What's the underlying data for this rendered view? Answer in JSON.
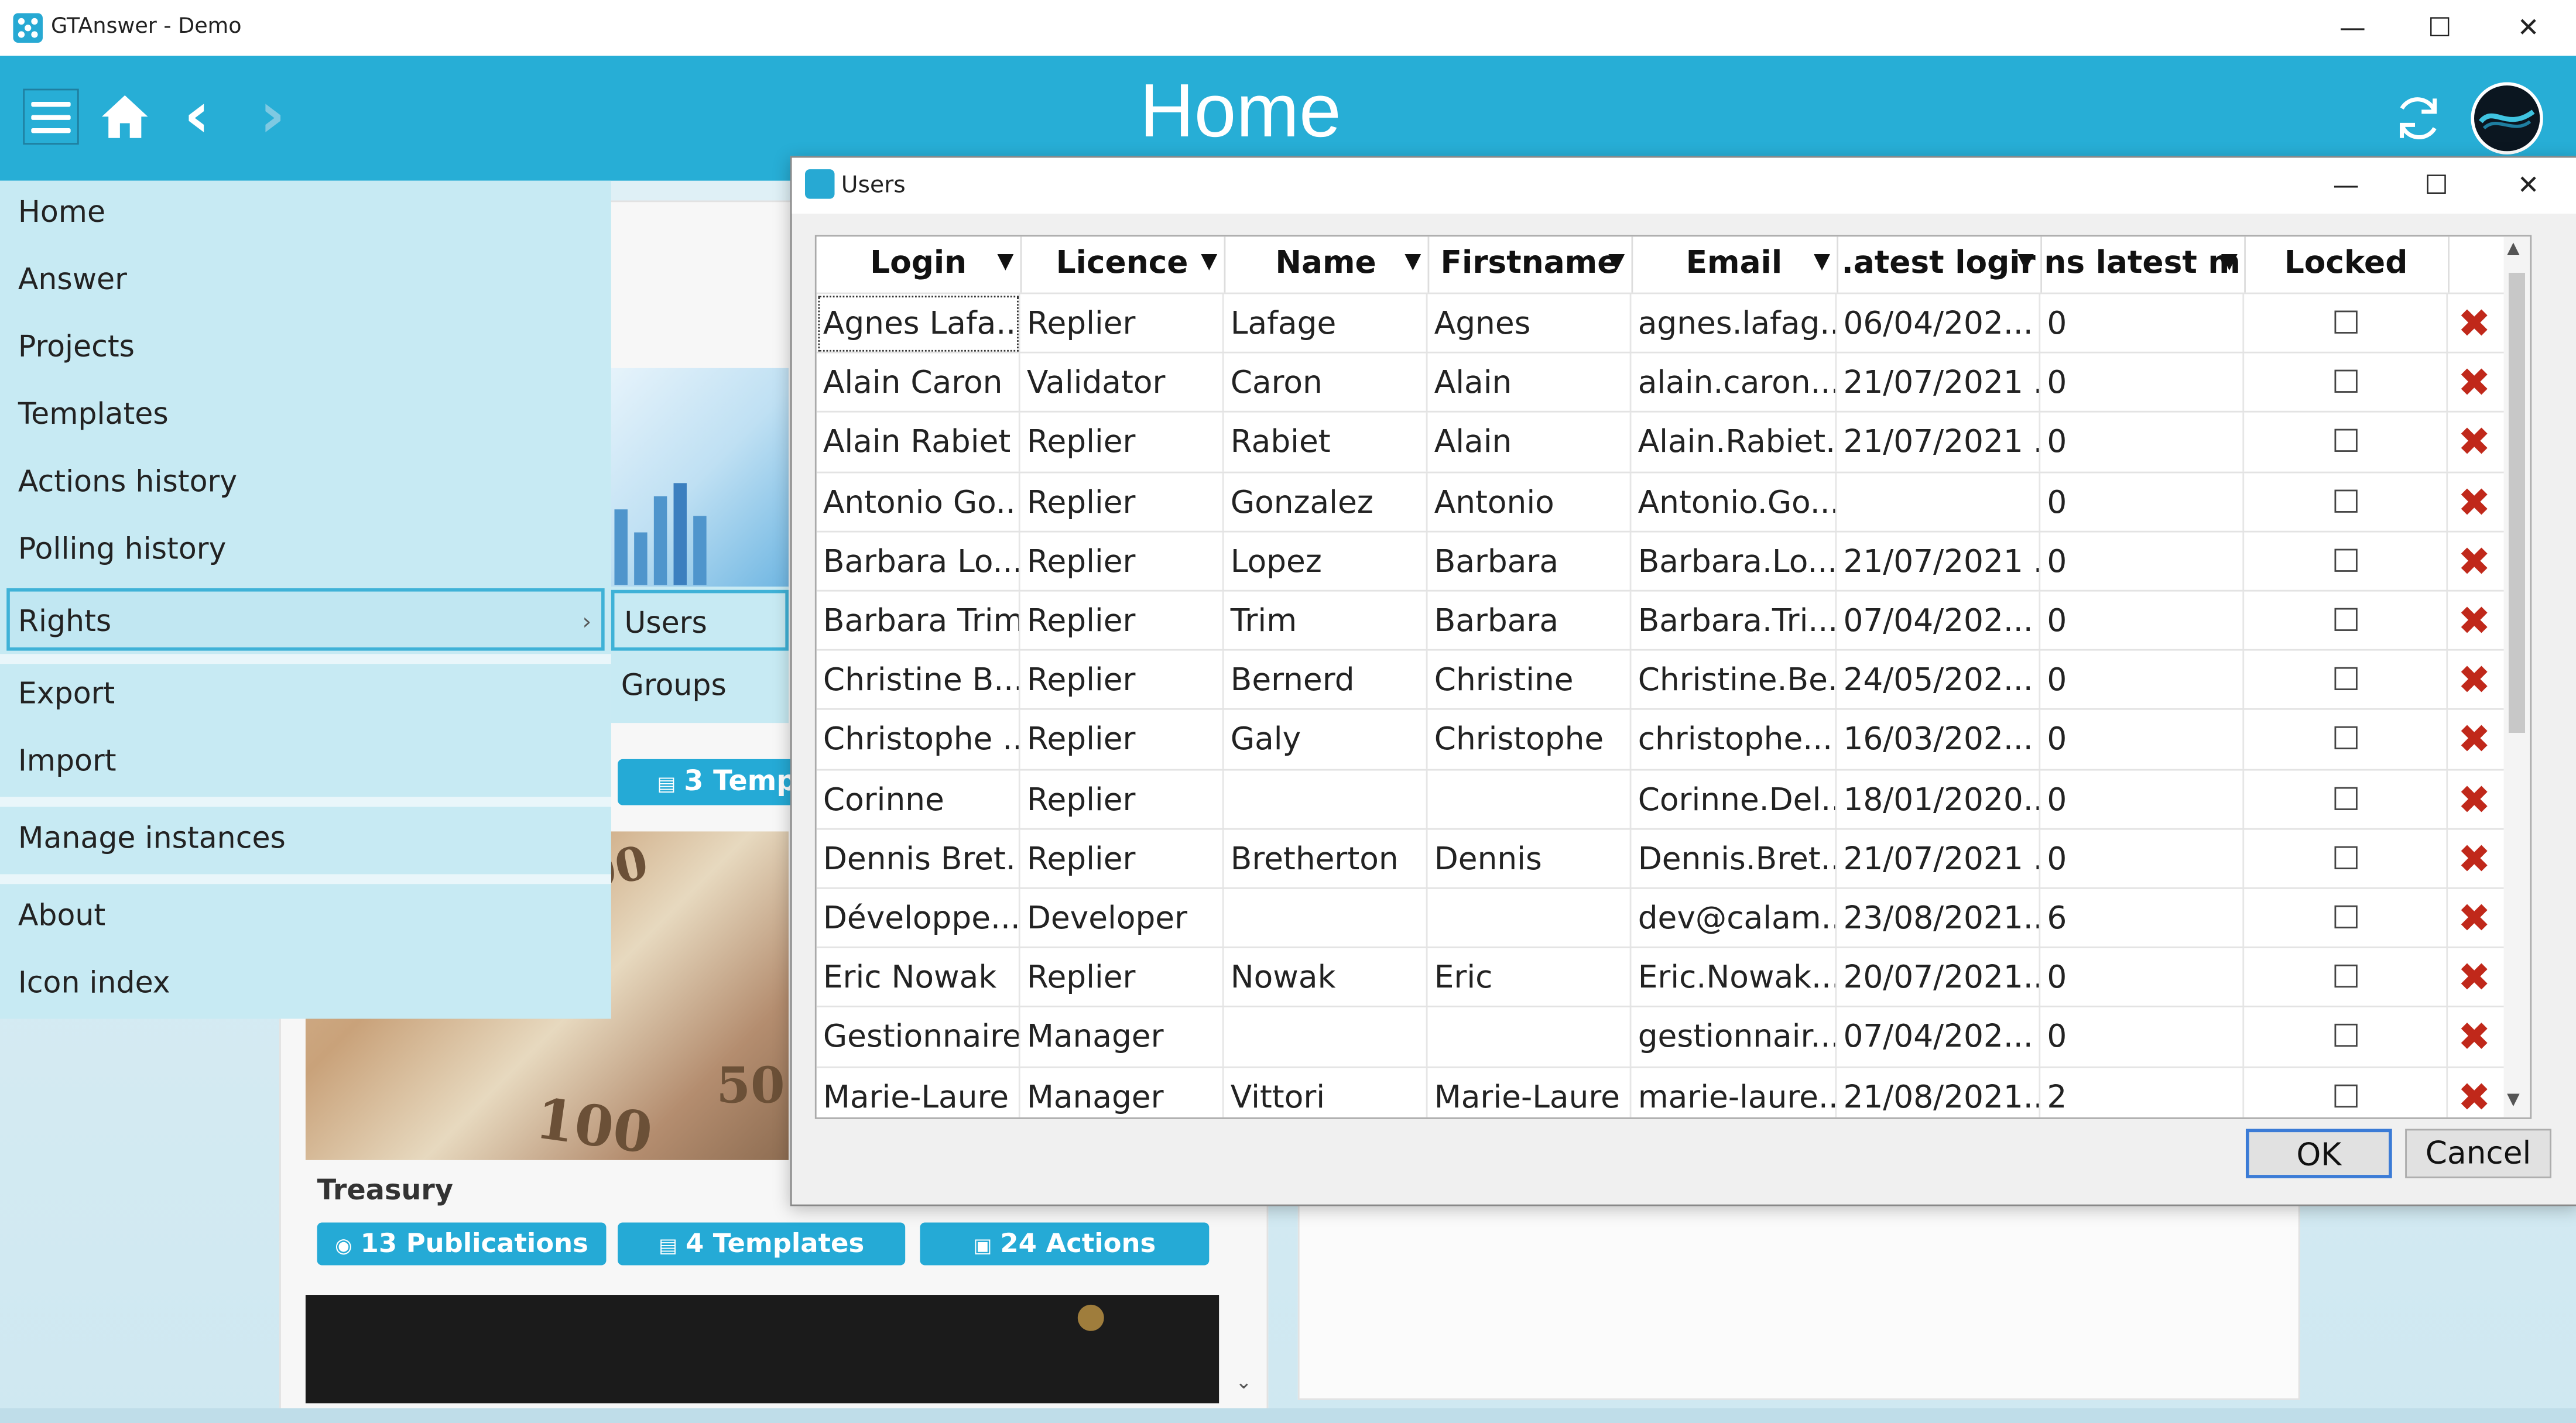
{
  "window": {
    "title": "GTAnswer - Demo",
    "minimize": "—",
    "maximize": "☐",
    "close": "✕"
  },
  "header": {
    "title": "Home",
    "back": "‹",
    "forward": "›",
    "home_icon": "home-icon",
    "refresh_icon": "refresh-icon"
  },
  "menu": {
    "items": [
      {
        "label": "Home"
      },
      {
        "label": "Answer"
      },
      {
        "label": "Projects"
      },
      {
        "label": "Templates"
      },
      {
        "label": "Actions history"
      },
      {
        "label": "Polling history"
      },
      {
        "label": "Rights",
        "active": true
      },
      {
        "label": "Export"
      },
      {
        "label": "Import"
      },
      {
        "label": "Manage instances"
      },
      {
        "label": "About"
      },
      {
        "label": "Icon index"
      }
    ],
    "submenu": [
      {
        "label": "Users",
        "active": true
      },
      {
        "label": "Groups"
      }
    ]
  },
  "background": {
    "partial_pill": "3 Temp",
    "card_title": "Treasury",
    "pills": [
      "13 Publications",
      "4 Templates",
      "24 Actions"
    ]
  },
  "dialog": {
    "title": "Users",
    "columns": [
      "Login",
      "Licence",
      "Name",
      "Firstname",
      "Email",
      "Latest login",
      "ns latest m",
      "Locked"
    ],
    "columns_display": [
      "Login",
      "Licence",
      "Name",
      "Firstname",
      "Email",
      ".atest logir",
      "ns latest m",
      "Locked"
    ],
    "rows": [
      [
        "Agnes Lafa...",
        "Replier",
        "Lafage",
        "Agnes",
        "agnes.lafag...",
        "06/04/202...",
        "0"
      ],
      [
        "Alain Caron",
        "Validator",
        "Caron",
        "Alain",
        "alain.caron...",
        "21/07/2021 ...",
        "0"
      ],
      [
        "Alain Rabiet",
        "Replier",
        "Rabiet",
        "Alain",
        "Alain.Rabiet...",
        "21/07/2021 ...",
        "0"
      ],
      [
        "Antonio Go...",
        "Replier",
        "Gonzalez",
        "Antonio",
        "Antonio.Go...",
        "",
        "0"
      ],
      [
        "Barbara Lo...",
        "Replier",
        "Lopez",
        "Barbara",
        "Barbara.Lo...",
        "21/07/2021 ...",
        "0"
      ],
      [
        "Barbara Trim",
        "Replier",
        "Trim",
        "Barbara",
        "Barbara.Tri...",
        "07/04/202...",
        "0"
      ],
      [
        "Christine B...",
        "Replier",
        "Bernerd",
        "Christine",
        "Christine.Be...",
        "24/05/202...",
        "0"
      ],
      [
        "Christophe ...",
        "Replier",
        "Galy",
        "Christophe",
        "christophe...",
        "16/03/202...",
        "0"
      ],
      [
        "Corinne",
        "Replier",
        "",
        "",
        "Corinne.Del...",
        "18/01/2020...",
        "0"
      ],
      [
        "Dennis Bret...",
        "Replier",
        "Bretherton",
        "Dennis",
        "Dennis.Bret...",
        "21/07/2021 ...",
        "0"
      ],
      [
        "Développe...",
        "Developer",
        "",
        "",
        "dev@calam...",
        "23/08/2021...",
        "6"
      ],
      [
        "Eric Nowak",
        "Replier",
        "Nowak",
        "Eric",
        "Eric.Nowak...",
        "20/07/2021...",
        "0"
      ],
      [
        "Gestionnaire",
        "Manager",
        "",
        "",
        "gestionnair...",
        "07/04/202...",
        "0"
      ],
      [
        "Marie-Laure",
        "Manager",
        "Vittori",
        "Marie-Laure",
        "marie-laure...",
        "21/08/2021...",
        "2"
      ]
    ],
    "delete_glyph": "✖",
    "ok": "OK",
    "cancel": "Cancel"
  },
  "colors": {
    "accent": "#27aed6",
    "menu_bg": "#c7eaf3",
    "delete": "#c0281a"
  }
}
